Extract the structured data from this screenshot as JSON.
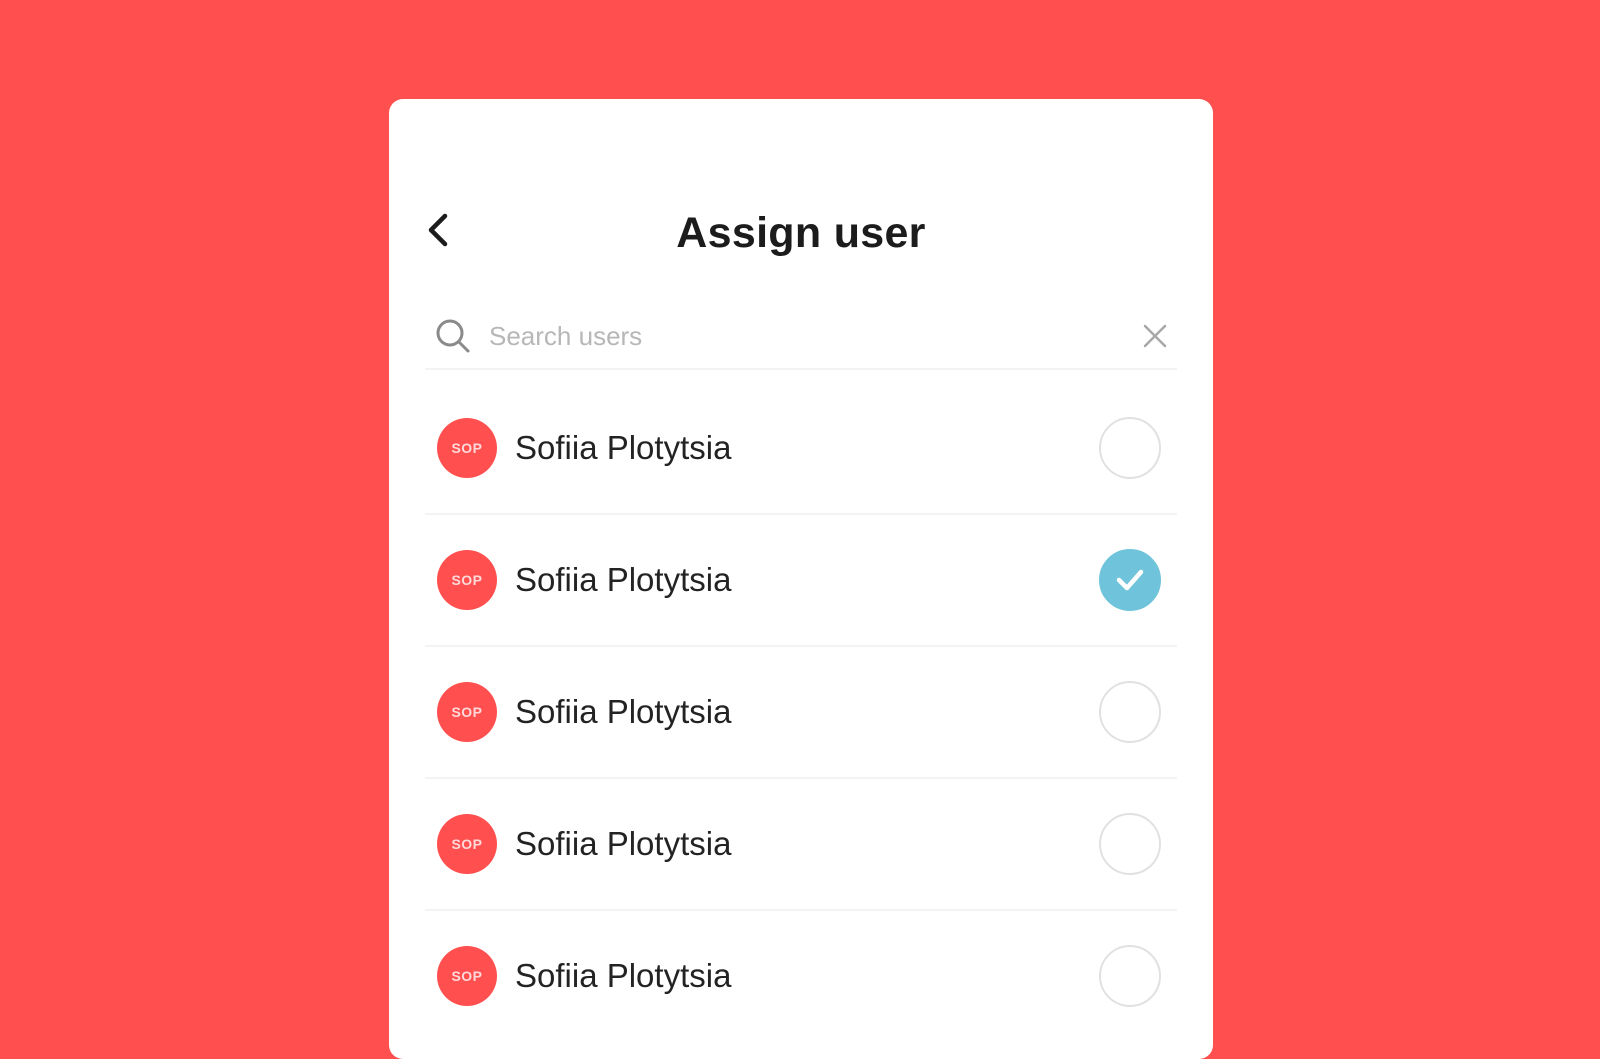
{
  "colors": {
    "background": "#FF4F4F",
    "card": "#FFFFFF",
    "avatar": "#FF4F4F",
    "check_accent": "#6FC3DA"
  },
  "header": {
    "title": "Assign user",
    "back_icon": "chevron-left-icon"
  },
  "search": {
    "placeholder": "Search users",
    "value": "",
    "icon": "search-icon",
    "clear_icon": "close-icon"
  },
  "users": [
    {
      "initials": "SOP",
      "name": "Sofiia Plotytsia",
      "selected": false
    },
    {
      "initials": "SOP",
      "name": "Sofiia Plotytsia",
      "selected": true
    },
    {
      "initials": "SOP",
      "name": "Sofiia Plotytsia",
      "selected": false
    },
    {
      "initials": "SOP",
      "name": "Sofiia Plotytsia",
      "selected": false
    },
    {
      "initials": "SOP",
      "name": "Sofiia Plotytsia",
      "selected": false
    }
  ]
}
